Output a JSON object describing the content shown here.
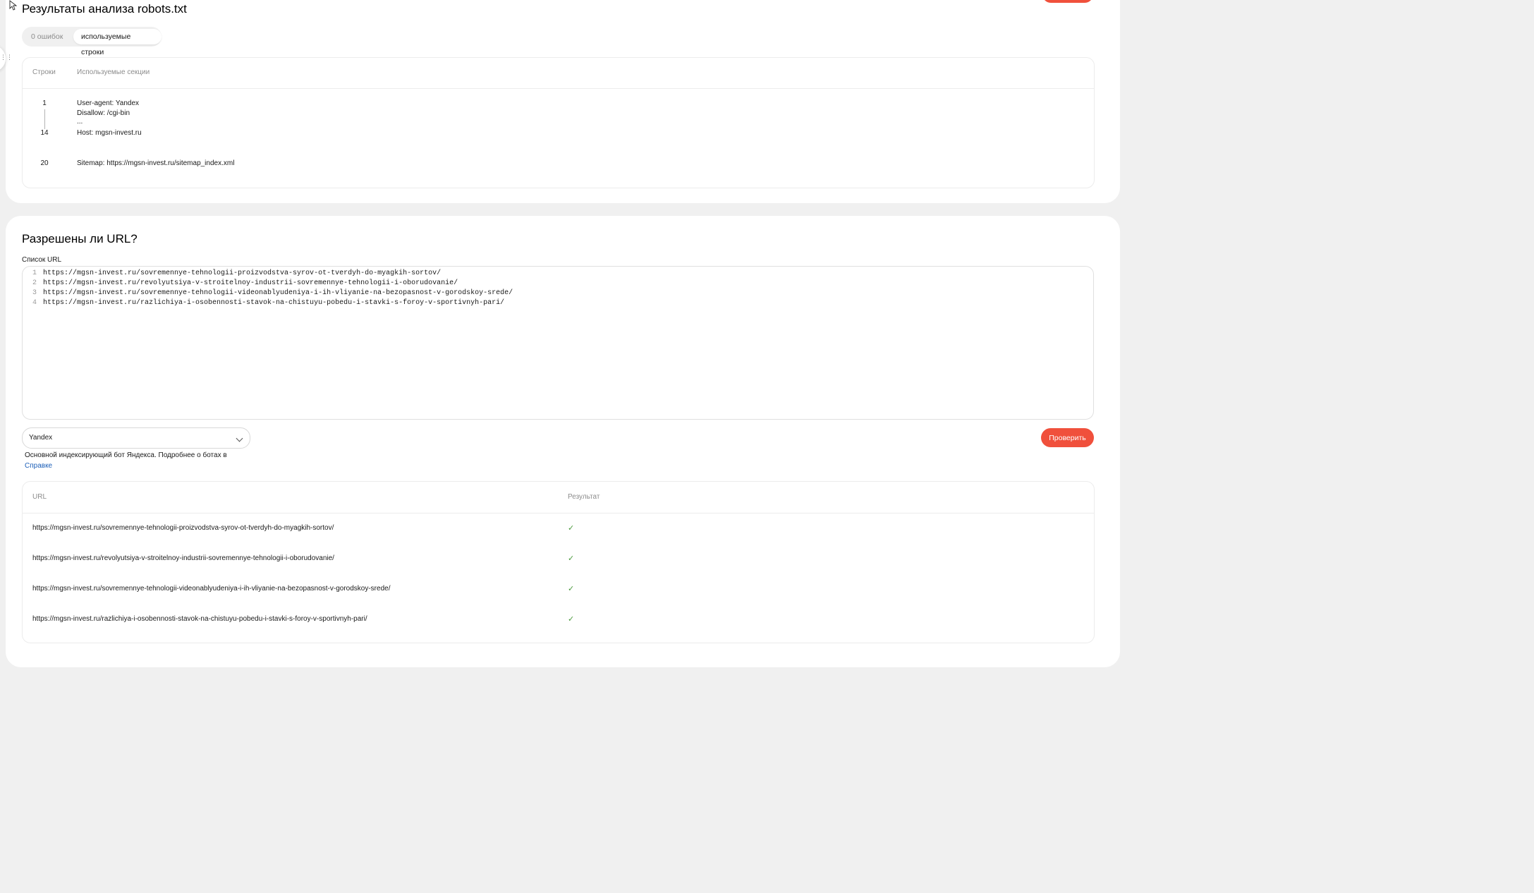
{
  "analysis": {
    "title": "Результаты анализа robots.txt",
    "tabs": [
      {
        "label": "0 ошибок",
        "active": false
      },
      {
        "label": "используемые строки",
        "active": true
      }
    ],
    "table": {
      "headers": {
        "lines": "Строки",
        "sections": "Используемые секции"
      },
      "groups": [
        {
          "start_line": "1",
          "end_line": "14",
          "lines": [
            "User-agent: Yandex",
            "Disallow: /cgi-bin",
            "...",
            "Host: mgsn-invest.ru"
          ]
        },
        {
          "start_line": "20",
          "lines": [
            "Sitemap: https://mgsn-invest.ru/sitemap_index.xml"
          ]
        }
      ]
    }
  },
  "url_check": {
    "title": "Разрешены ли URL?",
    "list_label": "Список URL",
    "editor_lines": [
      {
        "num": "1",
        "text": "https://mgsn-invest.ru/sovremennye-tehnologii-proizvodstva-syrov-ot-tverdyh-do-myagkih-sortov/"
      },
      {
        "num": "2",
        "text": "https://mgsn-invest.ru/revolyutsiya-v-stroitelnoy-industrii-sovremennye-tehnologii-i-oborudovanie/"
      },
      {
        "num": "3",
        "text": "https://mgsn-invest.ru/sovremennye-tehnologii-videonablyudeniya-i-ih-vliyanie-na-bezopasnost-v-gorodskoy-srede/"
      },
      {
        "num": "4",
        "text": "https://mgsn-invest.ru/razlichiya-i-osobennosti-stavok-na-chistuyu-pobedu-i-stavki-s-foroy-v-sportivnyh-pari/"
      }
    ],
    "bot_select": {
      "value": "Yandex"
    },
    "bot_description": "Основной индексирующий бот Яндекса. Подробнее о ботах в",
    "help_link": "Справке",
    "check_button": "Проверить",
    "results": {
      "headers": {
        "url": "URL",
        "result": "Результат"
      },
      "rows": [
        {
          "url": "https://mgsn-invest.ru/sovremennye-tehnologii-proizvodstva-syrov-ot-tverdyh-do-myagkih-sortov/",
          "result": "✓"
        },
        {
          "url": "https://mgsn-invest.ru/revolyutsiya-v-stroitelnoy-industrii-sovremennye-tehnologii-i-oborudovanie/",
          "result": "✓"
        },
        {
          "url": "https://mgsn-invest.ru/sovremennye-tehnologii-videonablyudeniya-i-ih-vliyanie-na-bezopasnost-v-gorodskoy-srede/",
          "result": "✓"
        },
        {
          "url": "https://mgsn-invest.ru/razlichiya-i-osobennosti-stavok-na-chistuyu-pobedu-i-stavki-s-foroy-v-sportivnyh-pari/",
          "result": "✓"
        }
      ]
    }
  },
  "colors": {
    "accent": "#f0503c",
    "link": "#1c5fb8",
    "success": "#4a9a3c",
    "background": "#f0f0f0"
  }
}
